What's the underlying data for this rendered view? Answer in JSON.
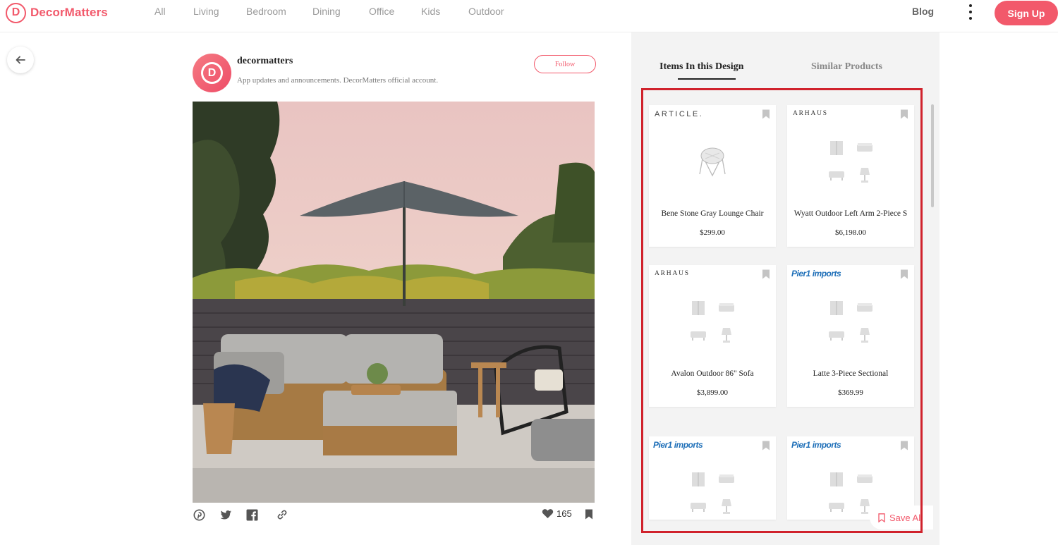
{
  "brand": {
    "name": "DecorMatters",
    "mark": "D"
  },
  "nav": {
    "items": [
      {
        "label": "All"
      },
      {
        "label": "Living"
      },
      {
        "label": "Bedroom"
      },
      {
        "label": "Dining"
      },
      {
        "label": "Office"
      },
      {
        "label": "Kids"
      },
      {
        "label": "Outdoor"
      }
    ],
    "blog_label": "Blog",
    "signup_label": "Sign Up"
  },
  "post": {
    "username": "decormatters",
    "bio": "App updates and announcements. DecorMatters official account.",
    "follow_label": "Follow",
    "likes": "165"
  },
  "panel": {
    "tabs": [
      {
        "label": "Items In this Design",
        "active": true
      },
      {
        "label": "Similar Products",
        "active": false
      }
    ],
    "products": [
      {
        "brand": "ARTICLE.",
        "name": "Bene Stone Gray Lounge Chair",
        "price": "$299.00"
      },
      {
        "brand": "ARHAUS",
        "name": "Wyatt Outdoor Left Arm 2-Piece S",
        "price": "$6,198.00"
      },
      {
        "brand": "ARHAUS",
        "name": "Avalon Outdoor 86\" Sofa",
        "price": "$3,899.00"
      },
      {
        "brand": "Pier1 imports",
        "name": "Latte 3-Piece Sectional",
        "price": "$369.99"
      },
      {
        "brand": "Pier1 imports",
        "name": "",
        "price": ""
      },
      {
        "brand": "Pier1 imports",
        "name": "",
        "price": ""
      }
    ],
    "save_all_label": "Save All"
  },
  "colors": {
    "accent": "#f2596b",
    "highlight": "#d0222c",
    "panel_bg": "#f3f3f3"
  }
}
